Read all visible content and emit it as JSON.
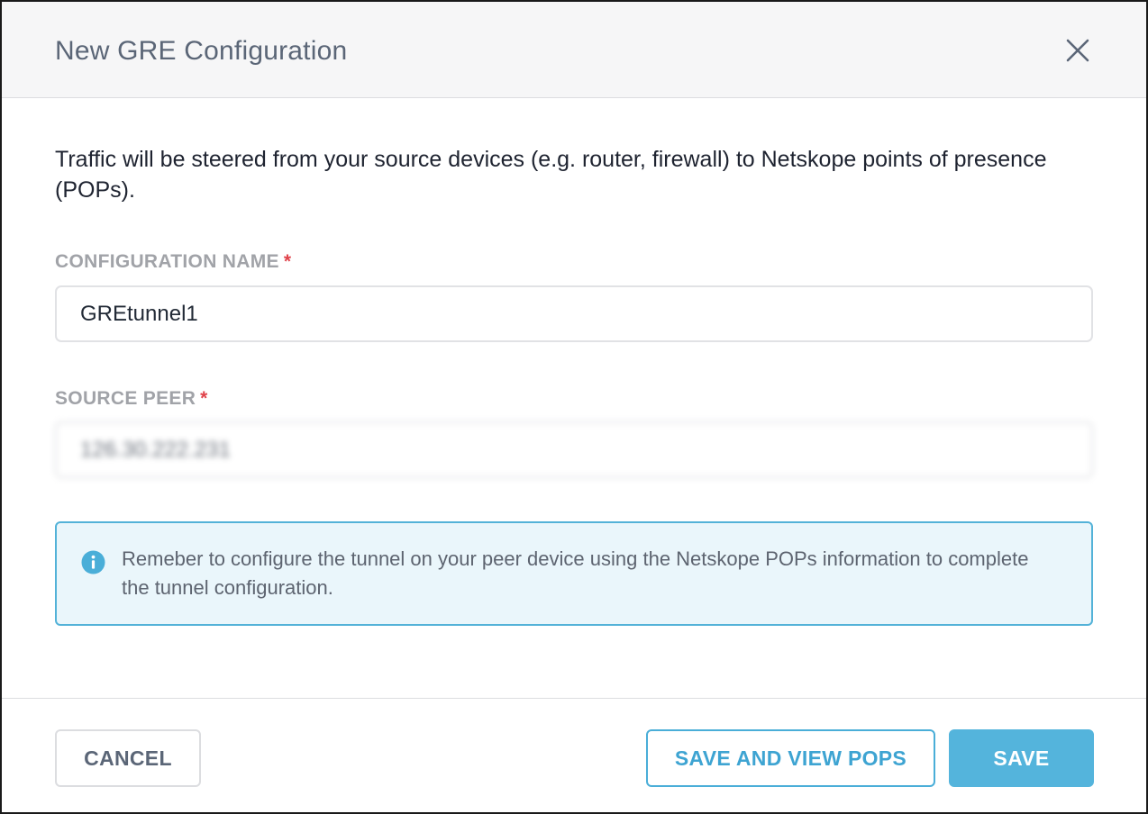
{
  "dialog": {
    "title": "New GRE Configuration",
    "close_icon": "close-icon"
  },
  "description": "Traffic will be steered from your source devices (e.g. router, firewall) to Netskope points of presence (POPs).",
  "fields": {
    "config_name": {
      "label": "CONFIGURATION NAME",
      "required_mark": "*",
      "value": "GREtunnel1"
    },
    "source_peer": {
      "label": "SOURCE PEER",
      "required_mark": "*",
      "value": "126.30.222.231"
    }
  },
  "info": {
    "icon": "info-icon",
    "text": "Remeber to configure the tunnel on your peer device using the Netskope POPs information to complete the tunnel configuration."
  },
  "buttons": {
    "cancel": "CANCEL",
    "save_and_view": "SAVE AND VIEW POPS",
    "save": "SAVE"
  },
  "colors": {
    "accent": "#54b4dc",
    "required": "#e0434b",
    "info_background": "#eaf6fb"
  }
}
